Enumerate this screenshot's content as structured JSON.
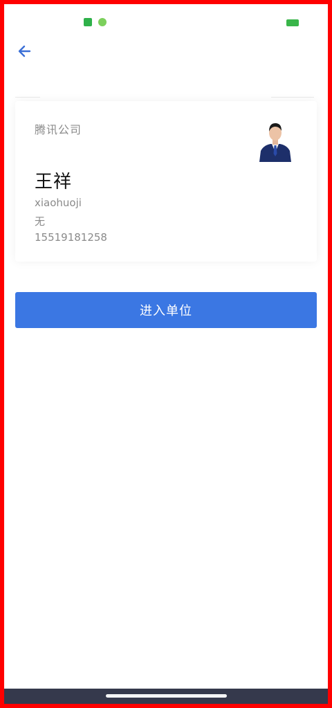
{
  "colors": {
    "accent": "#3b77e3",
    "frame": "#ff0000",
    "text_primary": "#111111",
    "text_secondary": "#8a8a8a"
  },
  "status_bar": {
    "icons": [
      "app-notification-icon",
      "wechat-icon",
      "battery-icon"
    ]
  },
  "header": {
    "back_icon": "arrow-left-icon"
  },
  "profile": {
    "company": "腾讯公司",
    "name": "王祥",
    "username": "xiaohuoji",
    "role": "无",
    "phone": "15519181258",
    "avatar_icon": "person-avatar"
  },
  "actions": {
    "enter_label": "进入单位"
  }
}
